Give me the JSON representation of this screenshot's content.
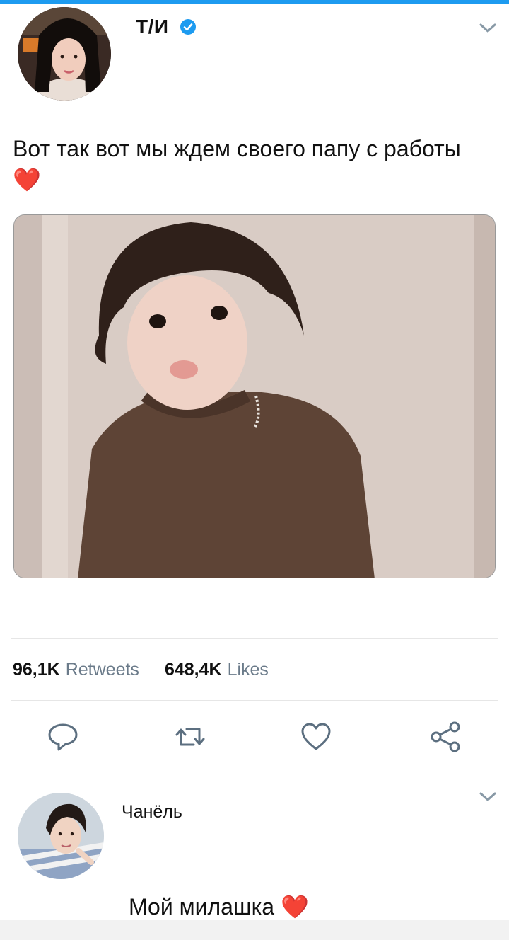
{
  "colors": {
    "accent": "#1d9bf0",
    "heart": "#e0182d",
    "muted": "#6b7b8a"
  },
  "tweet": {
    "author": "Т/И",
    "verified_icon": "verified-badge-icon",
    "text": "Вот так вот мы ждем своего папу с работы",
    "emoji": "❤️",
    "stats": {
      "retweets_count": "96,1K",
      "retweets_label": "Retweets",
      "likes_count": "648,4K",
      "likes_label": "Likes"
    },
    "actions": [
      "reply-icon",
      "retweet-icon",
      "like-icon",
      "share-icon"
    ]
  },
  "reply": {
    "author": "Чанёль",
    "text": "Мой милашка",
    "emoji": "❤️"
  }
}
